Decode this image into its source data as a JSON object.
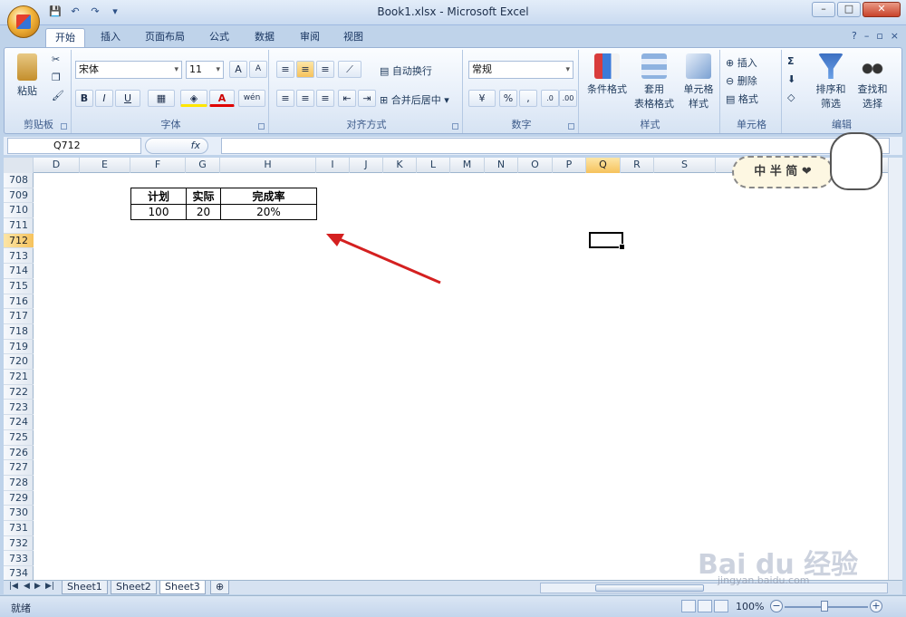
{
  "window": {
    "title": "Book1.xlsx - Microsoft Excel",
    "min": "–",
    "max": "□",
    "close": "✕"
  },
  "qat": {
    "save": "💾",
    "undo": "↶",
    "redo": "↷",
    "more": "▾"
  },
  "tabs": [
    "开始",
    "插入",
    "页面布局",
    "公式",
    "数据",
    "审阅",
    "视图"
  ],
  "ribbon": {
    "clipboard": {
      "label": "剪贴板",
      "paste": "粘贴"
    },
    "font": {
      "label": "字体",
      "name": "宋体",
      "size": "11",
      "grow": "A",
      "shrink": "A",
      "bold": "B",
      "italic": "I",
      "underline": "U",
      "wen": "wén"
    },
    "align": {
      "label": "对齐方式",
      "wrap": "自动换行",
      "merge": "合并后居中"
    },
    "number": {
      "label": "数字",
      "format": "常规",
      "percent": "%",
      "comma": ","
    },
    "styles": {
      "label": "样式",
      "cond": "条件格式",
      "table1": "套用",
      "table2": "表格格式",
      "cell1": "单元格",
      "cell2": "样式"
    },
    "cells": {
      "label": "单元格",
      "insert": "插入",
      "delete": "删除",
      "format": "格式"
    },
    "editing": {
      "label": "编辑",
      "sort1": "排序和",
      "sort2": "筛选",
      "find1": "查找和",
      "find2": "选择"
    }
  },
  "formula": {
    "namebox": "Q712",
    "fx": "fx"
  },
  "columns": [
    {
      "name": "D",
      "sel": false
    },
    {
      "name": "E",
      "sel": false
    },
    {
      "name": "F",
      "sel": false
    },
    {
      "name": "G",
      "sel": false
    },
    {
      "name": "H",
      "sel": false
    },
    {
      "name": "I",
      "sel": false
    },
    {
      "name": "J",
      "sel": false
    },
    {
      "name": "K",
      "sel": false
    },
    {
      "name": "L",
      "sel": false
    },
    {
      "name": "M",
      "sel": false
    },
    {
      "name": "N",
      "sel": false
    },
    {
      "name": "O",
      "sel": false
    },
    {
      "name": "P",
      "sel": false
    },
    {
      "name": "Q",
      "sel": true
    },
    {
      "name": "R",
      "sel": false
    },
    {
      "name": "S",
      "sel": false
    }
  ],
  "rows": [
    "708",
    "709",
    "710",
    "711",
    "712",
    "713",
    "714",
    "715",
    "716",
    "717",
    "718",
    "719",
    "720",
    "721",
    "722",
    "723",
    "724",
    "725",
    "726",
    "727",
    "728",
    "729",
    "730",
    "731",
    "732",
    "733",
    "734"
  ],
  "selected_row": "712",
  "table": {
    "headers": [
      "计划",
      "实际",
      "完成率"
    ],
    "values": [
      "100",
      "20",
      "20%"
    ]
  },
  "sheets": [
    "Sheet1",
    "Sheet2",
    "Sheet3"
  ],
  "active_sheet": "Sheet3",
  "status": {
    "ready": "就绪",
    "zoom": "100%"
  },
  "sticker": "中 半 简 ❤",
  "watermark": {
    "main": "Bai du 经验",
    "url": "jingyan.baidu.com"
  }
}
